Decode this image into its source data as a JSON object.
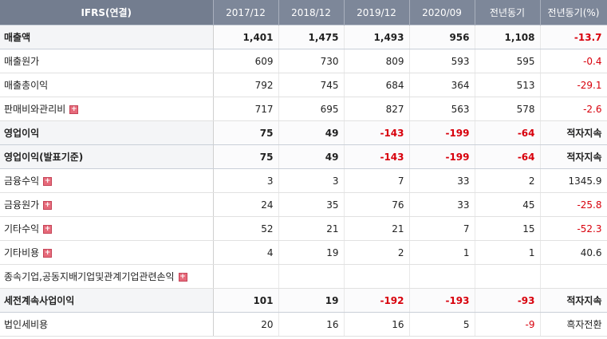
{
  "headers": [
    "IFRS(연결)",
    "2017/12",
    "2018/12",
    "2019/12",
    "2020/09",
    "전년동기",
    "전년동기(%)"
  ],
  "rows": [
    {
      "label": "매출액",
      "strong": true,
      "expand": false,
      "values": [
        "1,401",
        "1,475",
        "1,493",
        "956",
        "1,108",
        "-13.7"
      ],
      "neg": [
        false,
        false,
        false,
        false,
        false,
        true
      ]
    },
    {
      "label": "매출원가",
      "strong": false,
      "expand": false,
      "values": [
        "609",
        "730",
        "809",
        "593",
        "595",
        "-0.4"
      ],
      "neg": [
        false,
        false,
        false,
        false,
        false,
        true
      ]
    },
    {
      "label": "매출총이익",
      "strong": false,
      "expand": false,
      "values": [
        "792",
        "745",
        "684",
        "364",
        "513",
        "-29.1"
      ],
      "neg": [
        false,
        false,
        false,
        false,
        false,
        true
      ]
    },
    {
      "label": "판매비와관리비",
      "strong": false,
      "expand": true,
      "values": [
        "717",
        "695",
        "827",
        "563",
        "578",
        "-2.6"
      ],
      "neg": [
        false,
        false,
        false,
        false,
        false,
        true
      ]
    },
    {
      "label": "영업이익",
      "strong": true,
      "expand": false,
      "values": [
        "75",
        "49",
        "-143",
        "-199",
        "-64",
        "적자지속"
      ],
      "neg": [
        false,
        false,
        true,
        true,
        true,
        false
      ]
    },
    {
      "label": "영업이익(발표기준)",
      "strong": true,
      "expand": false,
      "values": [
        "75",
        "49",
        "-143",
        "-199",
        "-64",
        "적자지속"
      ],
      "neg": [
        false,
        false,
        true,
        true,
        true,
        false
      ]
    },
    {
      "label": "금융수익",
      "strong": false,
      "expand": true,
      "values": [
        "3",
        "3",
        "7",
        "33",
        "2",
        "1345.9"
      ],
      "neg": [
        false,
        false,
        false,
        false,
        false,
        false
      ]
    },
    {
      "label": "금융원가",
      "strong": false,
      "expand": true,
      "values": [
        "24",
        "35",
        "76",
        "33",
        "45",
        "-25.8"
      ],
      "neg": [
        false,
        false,
        false,
        false,
        false,
        true
      ]
    },
    {
      "label": "기타수익",
      "strong": false,
      "expand": true,
      "values": [
        "52",
        "21",
        "21",
        "7",
        "15",
        "-52.3"
      ],
      "neg": [
        false,
        false,
        false,
        false,
        false,
        true
      ]
    },
    {
      "label": "기타비용",
      "strong": false,
      "expand": true,
      "values": [
        "4",
        "19",
        "2",
        "1",
        "1",
        "40.6"
      ],
      "neg": [
        false,
        false,
        false,
        false,
        false,
        false
      ]
    },
    {
      "label": "종속기업,공동지배기업및관계기업관련손익",
      "strong": false,
      "expand": true,
      "values": [
        "",
        "",
        "",
        "",
        "",
        ""
      ],
      "neg": [
        false,
        false,
        false,
        false,
        false,
        false
      ]
    },
    {
      "label": "세전계속사업이익",
      "strong": true,
      "expand": false,
      "values": [
        "101",
        "19",
        "-192",
        "-193",
        "-93",
        "적자지속"
      ],
      "neg": [
        false,
        false,
        true,
        true,
        true,
        false
      ]
    },
    {
      "label": "법인세비용",
      "strong": false,
      "expand": false,
      "values": [
        "20",
        "16",
        "16",
        "5",
        "-9",
        "흑자전환"
      ],
      "neg": [
        false,
        false,
        false,
        false,
        true,
        false
      ]
    }
  ],
  "icons": {
    "expand": "plus-box-icon",
    "expand_symbol": "+"
  },
  "colors": {
    "header_bg": "#7d8799",
    "negative": "#d8000c",
    "expand_icon": "#e66a7a"
  }
}
